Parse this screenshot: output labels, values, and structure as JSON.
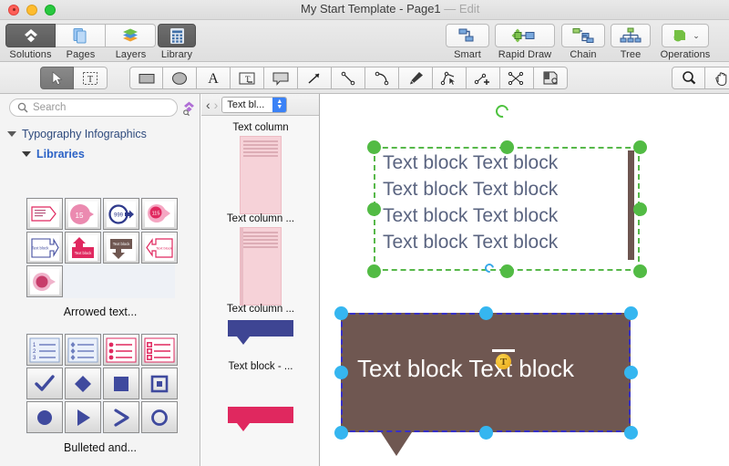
{
  "window": {
    "title": "My Start Template - Page1",
    "title_suffix": "— Edit",
    "controls": [
      "close",
      "minimize",
      "zoom"
    ]
  },
  "toolbar": {
    "left_group": [
      {
        "label": "Solutions",
        "icon": "solutions-icon",
        "active": true
      },
      {
        "label": "Pages",
        "icon": "pages-icon",
        "active": false
      },
      {
        "label": "Layers",
        "icon": "layers-icon",
        "active": false
      }
    ],
    "library": {
      "label": "Library",
      "icon": "library-grid-icon",
      "active": true
    },
    "right_group": [
      {
        "label": "Smart",
        "icon": "smart-connector-icon"
      },
      {
        "label": "Rapid Draw",
        "icon": "rapid-draw-icon"
      },
      {
        "label": "Chain",
        "icon": "chain-icon"
      },
      {
        "label": "Tree",
        "icon": "tree-icon"
      },
      {
        "label": "Operations",
        "icon": "operations-icon"
      }
    ]
  },
  "toolstrip": {
    "select_group": [
      {
        "name": "pointer-tool",
        "icon": "arrow-cursor-icon",
        "selected": true
      },
      {
        "name": "text-select-tool",
        "icon": "text-marquee-icon",
        "selected": false
      }
    ],
    "shape_group": [
      {
        "name": "rectangle-tool",
        "icon": "rectangle-icon"
      },
      {
        "name": "ellipse-tool",
        "icon": "ellipse-icon"
      },
      {
        "name": "text-tool",
        "icon": "letter-a-icon"
      },
      {
        "name": "text-field-tool",
        "icon": "text-field-icon"
      },
      {
        "name": "callout-tool",
        "icon": "callout-icon"
      },
      {
        "name": "arrow-tool",
        "icon": "arrow-diagonal-icon"
      },
      {
        "name": "line-tool",
        "icon": "line-icon"
      },
      {
        "name": "curve-tool",
        "icon": "curve-icon"
      },
      {
        "name": "pen-tool",
        "icon": "pen-nib-icon"
      },
      {
        "name": "edit-points-tool",
        "icon": "edit-points-icon"
      },
      {
        "name": "add-point-tool",
        "icon": "add-point-icon"
      },
      {
        "name": "connector-edit-tool",
        "icon": "connector-scissors-icon"
      },
      {
        "name": "hyperlink-tool",
        "icon": "hyperlink-card-icon"
      }
    ],
    "right_group": [
      {
        "name": "zoom-tool",
        "icon": "magnifier-icon"
      },
      {
        "name": "pan-tool",
        "icon": "hand-icon"
      }
    ]
  },
  "sidebar": {
    "search": {
      "placeholder": "Search",
      "value": "",
      "icon": "search-icon"
    },
    "pin_icon": "solutions-pin-icon",
    "tree": [
      {
        "label": "Typography Infographics",
        "level": 1,
        "expanded": true
      },
      {
        "label": "Libraries",
        "level": 2,
        "expanded": true
      }
    ],
    "library_groups": [
      {
        "caption": "Arrowed text...",
        "cells": [
          "arrow-tag-pink",
          "arrow-circle-15",
          "arrow-circle-999",
          "arrow-blob-115",
          "arrow-right-blue-box",
          "arrow-up-crimson",
          "arrow-down-brown",
          "arrow-left-pink",
          "arrow-circle-badge"
        ]
      },
      {
        "caption": "Bulleted and...",
        "cells": [
          "numbered-list",
          "diamond-bullet-list",
          "dot-bullet-list-pink",
          "square-bullet-list-pink",
          "checkmark-bullet",
          "diamond-bullet",
          "square-bullet",
          "square-outline-bullet",
          "circle-bullet",
          "triangle-bullet",
          "chevron-bullet",
          "circle-outline-bullet"
        ]
      }
    ]
  },
  "midpanel": {
    "nav_back": "‹",
    "nav_forward": "›",
    "selector_value": "Text bl...",
    "selector_icon": "stepper-arrows-icon",
    "items": [
      {
        "label": "Text column",
        "shape": "text-column"
      },
      {
        "label": "Text column ...",
        "shape": "text-column"
      },
      {
        "label": "Text column  ...",
        "shape": "text-column-2"
      },
      {
        "label": "Text block - ...",
        "shape": "callout-blue"
      },
      {
        "label": "",
        "shape": "callout-pink"
      }
    ]
  },
  "canvas": {
    "objects": [
      {
        "name": "text-block-group-selected",
        "selection_color": "#52bb44",
        "selection_style": "dashed",
        "accent_bar_color": "#6d5550",
        "text_color": "#5a6480",
        "lines": [
          "Text block Text block",
          "Text block Text block",
          "Text block Text block",
          "Text block Text block"
        ]
      },
      {
        "name": "callout-text-block-selected",
        "fill": "#6f5751",
        "selection_color": "#35b6f0",
        "dash_color": "#3730c8",
        "text_color": "#ffffff",
        "text": "Text block Text block",
        "cursor_icon": "text-cursor-icon"
      }
    ]
  }
}
